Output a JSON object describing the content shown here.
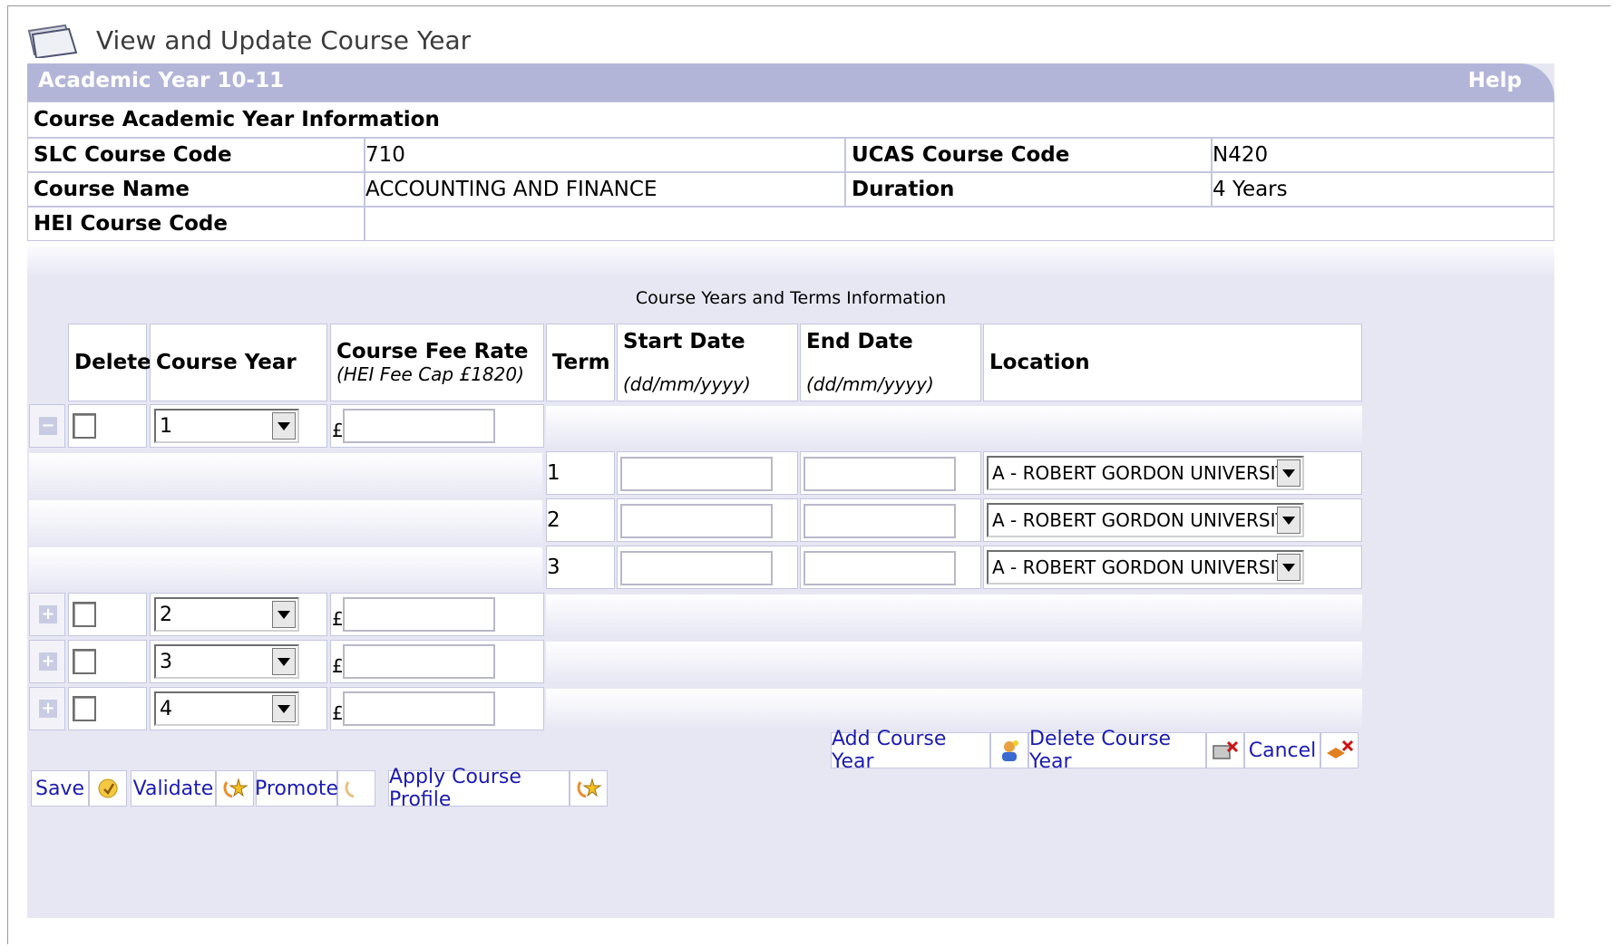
{
  "page": {
    "title": "View and Update Course Year"
  },
  "header": {
    "academic_year": "Academic Year 10-11",
    "help_label": "Help"
  },
  "info": {
    "section_title": "Course Academic Year Information",
    "slc_label": "SLC Course Code",
    "slc_value": "710",
    "ucas_label": "UCAS Course Code",
    "ucas_value": "N420",
    "name_label": "Course Name",
    "name_value": "ACCOUNTING AND FINANCE",
    "duration_label": "Duration",
    "duration_value": "4 Years",
    "hei_label": "HEI Course Code",
    "hei_value": ""
  },
  "years_section": {
    "title": "Course Years and Terms Information",
    "headers": {
      "delete": "Delete",
      "course_year": "Course Year",
      "fee_rate": "Course Fee Rate",
      "fee_cap": "(HEI Fee Cap £1820)",
      "term": "Term",
      "start_date": "Start Date",
      "end_date": "End Date",
      "date_format": "(dd/mm/yyyy)",
      "location": "Location"
    },
    "currency_symbol": "£",
    "years": [
      {
        "year": "1",
        "expander": "−"
      },
      {
        "year": "2",
        "expander": "+"
      },
      {
        "year": "3",
        "expander": "+"
      },
      {
        "year": "4",
        "expander": "+"
      }
    ],
    "terms": [
      {
        "term": "1",
        "location": "A - ROBERT GORDON UNIVERSITY"
      },
      {
        "term": "2",
        "location": "A - ROBERT GORDON UNIVERSITY"
      },
      {
        "term": "3",
        "location": "A - ROBERT GORDON UNIVERSITY"
      }
    ]
  },
  "actions": {
    "add_course_year": "Add Course Year",
    "delete_course_year": "Delete Course Year",
    "cancel": "Cancel",
    "save": "Save",
    "validate": "Validate",
    "promote": "Promote",
    "apply_course_profile": "Apply Course Profile"
  }
}
